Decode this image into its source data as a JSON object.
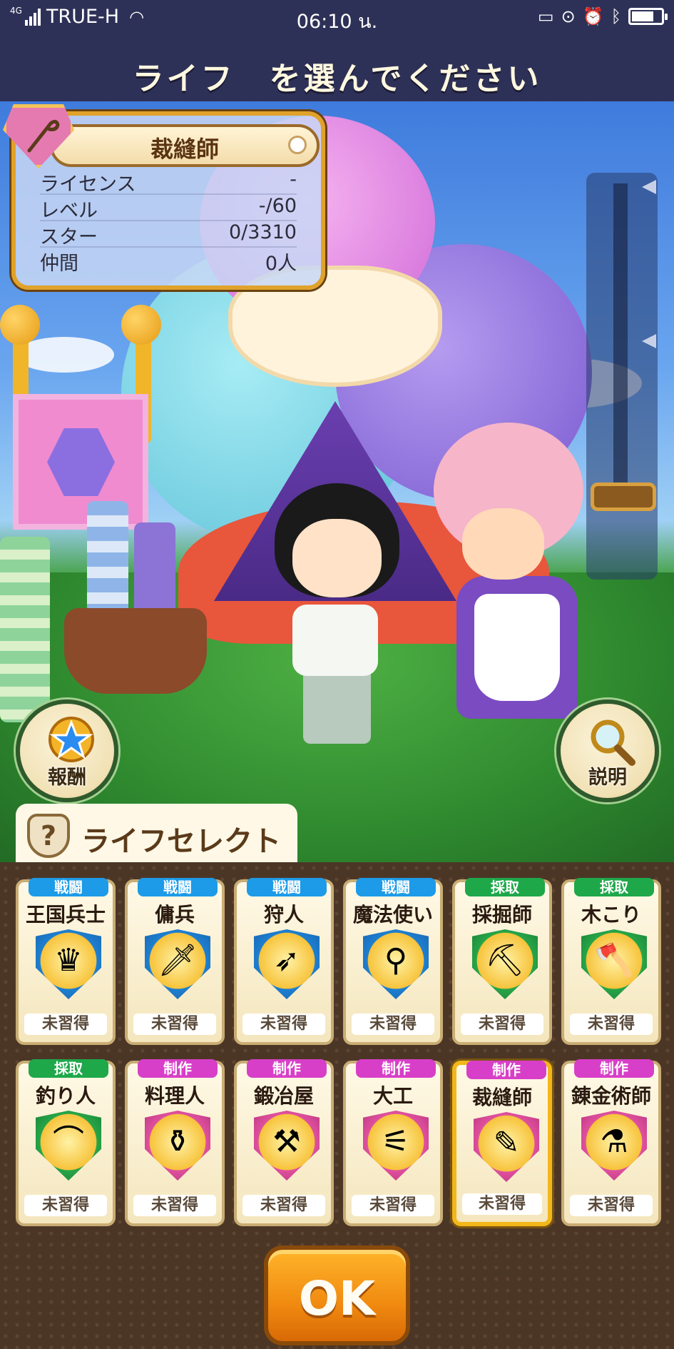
{
  "status_bar": {
    "network_type": "4G",
    "carrier": "TRUE-H",
    "time": "06:10 น.",
    "battery_level": 0.75
  },
  "header": {
    "title": "ライフ　を選んでください"
  },
  "selected_life": {
    "name": "裁縫師",
    "rows": [
      {
        "label": "ライセンス",
        "value": "-"
      },
      {
        "label": "レベル",
        "value": "-/60"
      },
      {
        "label": "スター",
        "value": "0/3310"
      },
      {
        "label": "仲間",
        "value": "0人"
      }
    ]
  },
  "buttons": {
    "reward": "報酬",
    "explain": "説明",
    "ok": "OK"
  },
  "tab": {
    "icon_text": "?",
    "label": "ライフセレクト"
  },
  "jobs": [
    {
      "category": "戦闘",
      "kind": "combat",
      "name": "王国兵士",
      "status": "未習得",
      "icon": "crown-icon",
      "glyph": "♛"
    },
    {
      "category": "戦闘",
      "kind": "combat",
      "name": "傭兵",
      "status": "未習得",
      "icon": "sword-icon",
      "glyph": "🗡"
    },
    {
      "category": "戦闘",
      "kind": "combat",
      "name": "狩人",
      "status": "未習得",
      "icon": "bow-icon",
      "glyph": "➶"
    },
    {
      "category": "戦闘",
      "kind": "combat",
      "name": "魔法使い",
      "status": "未習得",
      "icon": "wand-icon",
      "glyph": "⚲"
    },
    {
      "category": "採取",
      "kind": "gather",
      "name": "採掘師",
      "status": "未習得",
      "icon": "pickaxe-icon",
      "glyph": "⛏"
    },
    {
      "category": "採取",
      "kind": "gather",
      "name": "木こり",
      "status": "未習得",
      "icon": "axe-icon",
      "glyph": "🪓"
    },
    {
      "category": "採取",
      "kind": "gather",
      "name": "釣り人",
      "status": "未習得",
      "icon": "fishing-rod-icon",
      "glyph": "⌒"
    },
    {
      "category": "制作",
      "kind": "craft",
      "name": "料理人",
      "status": "未習得",
      "icon": "ladle-icon",
      "glyph": "⚱"
    },
    {
      "category": "制作",
      "kind": "craft",
      "name": "鍛冶屋",
      "status": "未習得",
      "icon": "hammer-icon",
      "glyph": "⚒"
    },
    {
      "category": "制作",
      "kind": "craft",
      "name": "大工",
      "status": "未習得",
      "icon": "saw-icon",
      "glyph": "⚟"
    },
    {
      "category": "制作",
      "kind": "craft",
      "name": "裁縫師",
      "status": "未習得",
      "icon": "needle-icon",
      "glyph": "✎"
    },
    {
      "category": "制作",
      "kind": "craft",
      "name": "錬金術師",
      "status": "未習得",
      "icon": "flask-icon",
      "glyph": "⚗"
    }
  ],
  "selected_job_index": 10,
  "colors": {
    "header_bg": "#2e3157",
    "combat_tag": "#1d9be8",
    "gather_tag": "#1ea84a",
    "craft_tag": "#d83fc8",
    "ok_button": "#f08a10",
    "selected_border": "#f2b71a"
  }
}
